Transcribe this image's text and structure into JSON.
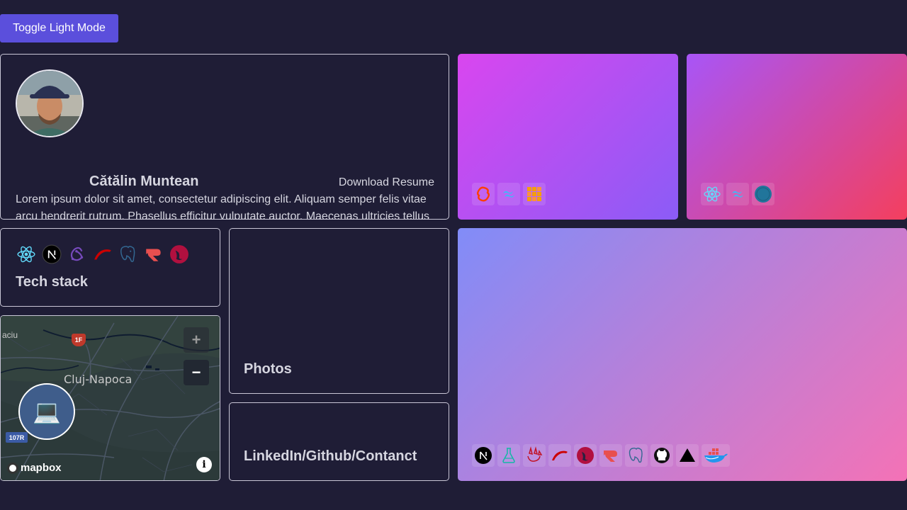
{
  "toggle": {
    "label": "Toggle Light Mode"
  },
  "profile": {
    "name": "Cătălin Muntean",
    "resume_label": "Download Resume",
    "bio": "Lorem ipsum dolor sit amet, consectetur adipiscing elit. Aliquam semper felis vitae arcu hendrerit rutrum. Phasellus efficitur vulputate auctor. Maecenas ultricies tellus vitae eleifend sodales. Etiam justo sapien, eleifend a suscipit at, gravida sit amet quam."
  },
  "tech_stack": {
    "title": "Tech stack",
    "icons": [
      "react-icon",
      "nextjs-icon",
      "redux-icon",
      "rails-icon",
      "postgresql-icon",
      "rescript-icon",
      "nestjs-icon"
    ]
  },
  "photos": {
    "title": "Photos"
  },
  "links": {
    "title": "LinkedIn/Github/Contanct"
  },
  "map": {
    "city": "Cluj-Napoca",
    "place_partial": "aciu",
    "shield_1": "1F",
    "shield_2": "107R",
    "zoom_in": "+",
    "zoom_out": "−",
    "attribution": "mapbox",
    "info": "i",
    "marker_emoji": "💻"
  },
  "projects": [
    {
      "icons": [
        "svelte-icon",
        "tailwind-icon",
        "sanity-icon"
      ]
    },
    {
      "icons": [
        "react-icon",
        "tailwind-icon",
        "wordpress-icon"
      ]
    },
    {
      "icons": [
        "nextjs-icon",
        "flask-icon",
        "jest-icon",
        "rails-icon",
        "nestjs-icon",
        "rescript-icon",
        "postgresql-icon",
        "github-icon",
        "vercel-icon",
        "docker-icon"
      ]
    }
  ],
  "colors": {
    "background": "#1f1d36",
    "accent": "#5b4fdc",
    "card_border": "#c9c6d6"
  }
}
